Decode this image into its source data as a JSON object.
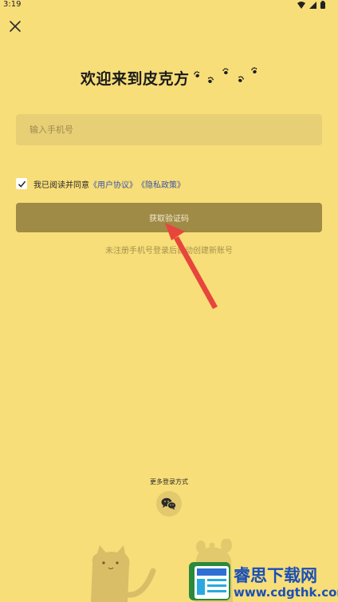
{
  "status_bar": {
    "time": "3:19",
    "icons": [
      "wifi-icon",
      "signal-icon",
      "battery-icon"
    ]
  },
  "header": {
    "close_icon": "close-icon",
    "title": "欢迎来到皮克方"
  },
  "form": {
    "phone_placeholder": "输入手机号",
    "agree_text": "我已阅读并同意",
    "user_agreement": "《用户协议》",
    "privacy_policy": "《隐私政策》",
    "agree_checked": true,
    "get_code_button": "获取验证码",
    "hint": "未注册手机号登录后自动创建新账号"
  },
  "more_login": {
    "label": "更多登录方式",
    "wechat_icon": "wechat-icon"
  },
  "watermark": {
    "title": "睿思下载网",
    "url": "www.cdgthk.com"
  },
  "colors": {
    "background": "#F8DE78",
    "input_background": "#E7CF75",
    "button_background": "#9F8A46",
    "link": "#3B56A6",
    "arrow": "#E8453C"
  }
}
